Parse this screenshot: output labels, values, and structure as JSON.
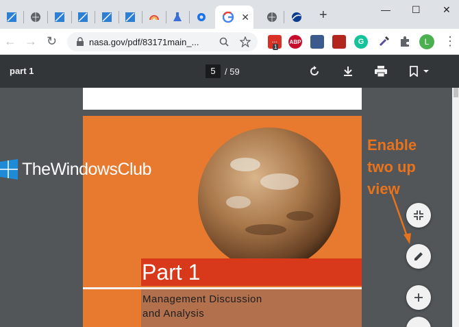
{
  "browser": {
    "tab_close_glyph": "✕",
    "new_tab_glyph": "+",
    "window": {
      "minimize": "—",
      "maximize": "☐",
      "close": "✕"
    },
    "tabs": [
      {
        "icon": "blue-square-icon",
        "color": "#2d7fd3"
      },
      {
        "icon": "globe-icon",
        "color": "#5f6368"
      },
      {
        "icon": "blue-square-icon",
        "color": "#2d7fd3"
      },
      {
        "icon": "blue-square-icon",
        "color": "#2d7fd3"
      },
      {
        "icon": "blue-square-icon",
        "color": "#2d7fd3"
      },
      {
        "icon": "blue-square-icon",
        "color": "#2d7fd3"
      },
      {
        "icon": "rainbow-icon",
        "color": "#e8a33d"
      },
      {
        "icon": "flask-icon",
        "color": "#3a6fd8"
      },
      {
        "icon": "gear-icon",
        "color": "#1a73e8"
      },
      {
        "icon": "google-icon",
        "color": "#4285f4",
        "active": true
      },
      {
        "icon": "globe-icon",
        "color": "#5f6368"
      },
      {
        "icon": "nasa-icon",
        "color": "#0b3d91"
      }
    ]
  },
  "toolbar": {
    "back": "←",
    "forward": "→",
    "reload": "↻",
    "url": "nasa.gov/pdf/83171main_...",
    "extensions": [
      {
        "icon": "red-badge-extension-icon",
        "label": "···",
        "badge": "1",
        "color": "#d93025"
      },
      {
        "icon": "abp-icon",
        "label": "ABP",
        "color": "#c70d2c"
      },
      {
        "icon": "blue-extension-icon",
        "label": "",
        "color": "#3b5b8f"
      },
      {
        "icon": "red-book-extension-icon",
        "label": "",
        "color": "#b3261e"
      },
      {
        "icon": "grammarly-icon",
        "label": "G",
        "color": "#15c39a"
      },
      {
        "icon": "eyedropper-icon",
        "label": "",
        "color": "#5b4a9e"
      }
    ],
    "profile_initial": "L",
    "menu": "⋮"
  },
  "pdf": {
    "title": "part 1",
    "page_current": "5",
    "page_total": "/ 59",
    "page_heading": "Part 1",
    "page_subheading_line1": "Management Discussion",
    "page_subheading_line2": "and Analysis"
  },
  "watermark": {
    "text": "TheWindowsClub"
  },
  "annotation": {
    "line1": "Enable",
    "line2": "two up",
    "line3": "view",
    "color": "#e8731c"
  },
  "fabs": [
    {
      "icon": "fit-to-page-icon"
    },
    {
      "icon": "pencil-icon"
    },
    {
      "icon": "zoom-in-icon"
    },
    {
      "icon": "zoom-out-icon"
    }
  ]
}
